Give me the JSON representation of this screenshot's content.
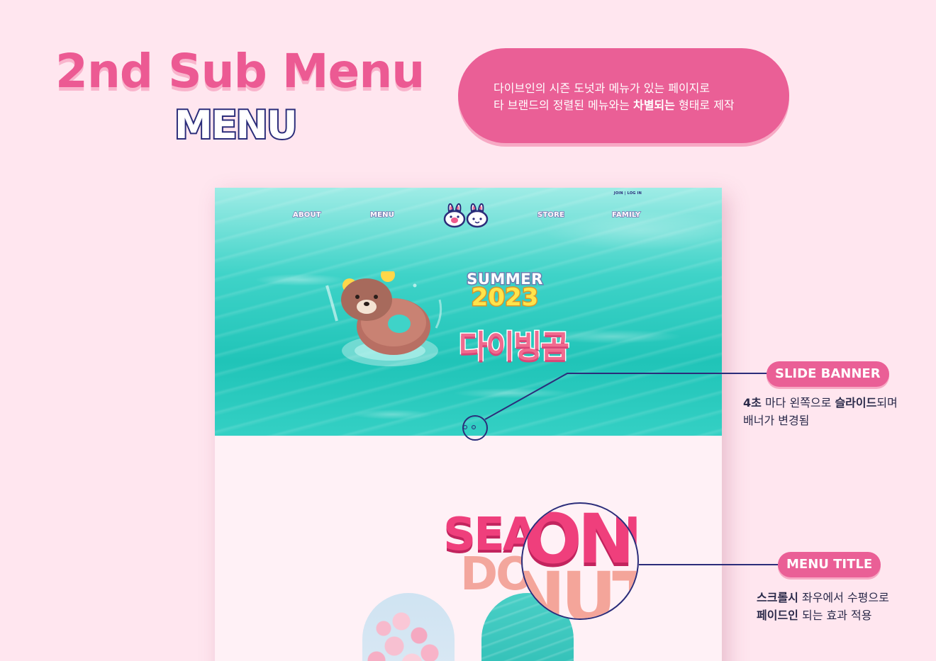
{
  "header": {
    "title": "2nd Sub Menu",
    "subtitle": "MENU"
  },
  "description": {
    "line1": "다이브인의 시즌 도넛과 메뉴가 있는 페이지로",
    "line2_prefix": "타 브랜드의 정렬된 메뉴와는 ",
    "line2_bold": "차별되는",
    "line2_suffix": " 형태로 제작"
  },
  "mockup": {
    "top_links": "JOIN | LOG IN",
    "nav": {
      "about": "ABOUT",
      "menu": "MENU",
      "store": "STORE",
      "family": "FAMILY"
    },
    "hero": {
      "season": "SUMMER",
      "year": "2023",
      "product": "다이빙곰"
    },
    "slide_count": 2,
    "active_slide": 1,
    "season_title": {
      "line1": "SEASON",
      "line2": "DONUT"
    }
  },
  "annotations": {
    "slide_banner": {
      "label": "SLIDE BANNER",
      "note_bold1": "4초",
      "note_mid1": " 마다 왼쪽으로 ",
      "note_bold2": "슬라이드",
      "note_end1": "되며",
      "note_line2": "배너가 변경됨"
    },
    "menu_title": {
      "label": "MENU TITLE",
      "note_bold1": "스크롤시",
      "note_end1": " 좌우에서 수평으로",
      "note_bold2": "페이드인",
      "note_end2": " 되는 효과 적용"
    }
  },
  "colors": {
    "background": "#ffe6ef",
    "accent_pink": "#ea5f96",
    "navy": "#2b2d7a",
    "water": "#34d0c4"
  },
  "icons": [
    "bunny-logo-icon",
    "bear-float-icon"
  ]
}
